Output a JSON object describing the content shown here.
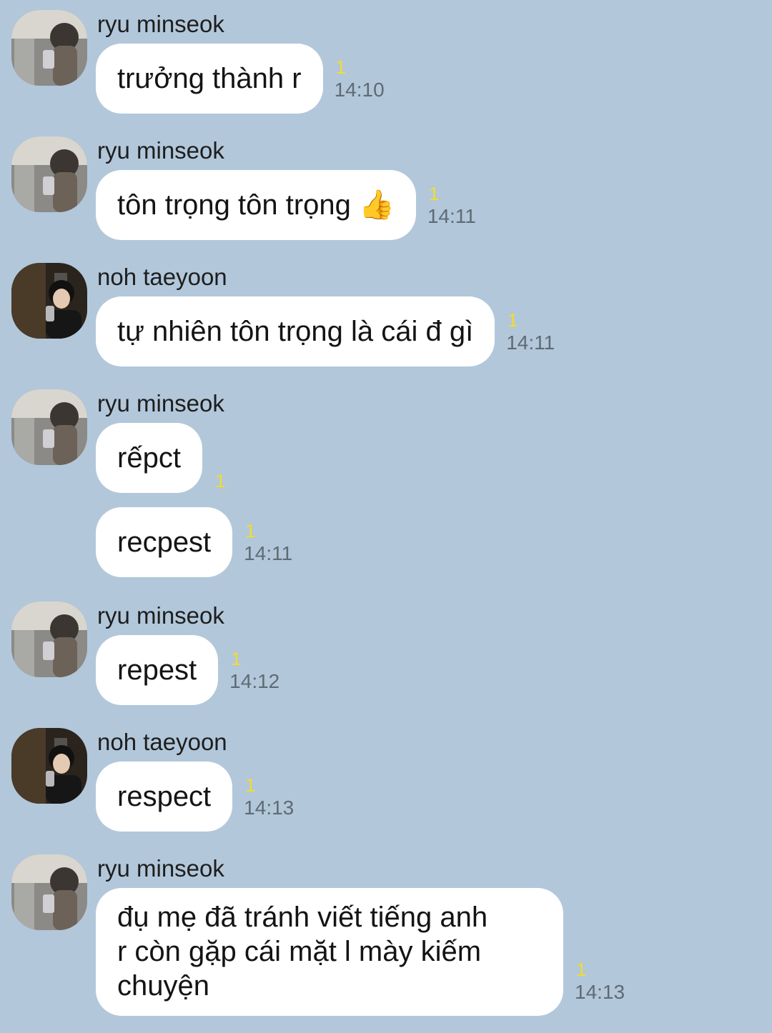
{
  "colors": {
    "background": "#b2c7da",
    "bubble": "#ffffff",
    "unread_count": "#f3dc2c",
    "timestamp": "#5e6b75"
  },
  "messages": [
    {
      "sender": "ryu minseok",
      "avatar": "avatar-ryu-minseok",
      "text": "trưởng thành r",
      "unread": "1",
      "time": "14:10"
    },
    {
      "sender": "ryu minseok",
      "avatar": "avatar-ryu-minseok",
      "text": "tôn trọng tôn trọng 👍",
      "unread": "1",
      "time": "14:11"
    },
    {
      "sender": "noh taeyoon",
      "avatar": "avatar-noh-taeyoon",
      "text": "tự nhiên tôn trọng là cái đ gì",
      "unread": "1",
      "time": "14:11"
    },
    {
      "sender": "ryu minseok",
      "avatar": "avatar-ryu-minseok",
      "text": "rếpct",
      "unread": "1",
      "time": ""
    },
    {
      "sender": "",
      "avatar": "",
      "text": "recpest",
      "unread": "1",
      "time": "14:11"
    },
    {
      "sender": "ryu minseok",
      "avatar": "avatar-ryu-minseok",
      "text": "repest",
      "unread": "1",
      "time": "14:12"
    },
    {
      "sender": "noh taeyoon",
      "avatar": "avatar-noh-taeyoon",
      "text": "respect",
      "unread": "1",
      "time": "14:13"
    },
    {
      "sender": "ryu minseok",
      "avatar": "avatar-ryu-minseok",
      "text_lines": [
        "đụ mẹ đã tránh viết tiếng anh",
        "r còn gặp cái mặt l mày kiếm",
        "chuyện"
      ],
      "unread": "1",
      "time": "14:13"
    }
  ]
}
